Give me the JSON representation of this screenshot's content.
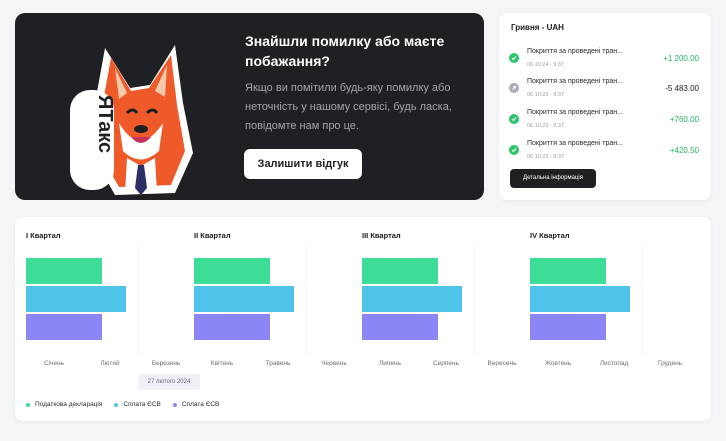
{
  "banner": {
    "title": "Знайшли помилку або маєте побажання?",
    "text": "Якщо ви помітили будь-яку помилку або неточність у нашому сервісі, будь ласка, повідомте нам про це.",
    "button_label": "Залишити відгук",
    "sticker_text": "ЯТакс",
    "background": "#1f2023"
  },
  "transactions": {
    "title": "Гривня - UAH",
    "items": [
      {
        "name": "Покриття за проведені тран...",
        "date": "06.10.24 - 9:37",
        "amount": "+1 200.00",
        "status": "success",
        "icon": "check-icon"
      },
      {
        "name": "Покриття за проведені тран...",
        "date": "06.10.23 - 9:37",
        "amount": "-5 483.00",
        "status": "pending",
        "icon": "arrow-icon"
      },
      {
        "name": "Покриття за проведені тран...",
        "date": "06.10.23 - 9:37",
        "amount": "+760.00",
        "status": "success",
        "icon": "check-icon"
      },
      {
        "name": "Покриття за проведені тран...",
        "date": "06.10.23 - 9:37",
        "amount": "+420.50",
        "status": "success",
        "icon": "check-icon"
      }
    ],
    "details_button": "Детальна інформація",
    "colors": {
      "positive": "#22b35e",
      "negative": "#1b1c20",
      "success_icon": "#2cc56b",
      "pending_icon": "#a8acb8"
    }
  },
  "chart_data": {
    "type": "bar",
    "orientation": "horizontal",
    "quarters": [
      {
        "label": "I Квартал",
        "months": [
          "Січень",
          "Лютий"
        ],
        "values": [
          76,
          100,
          76
        ]
      },
      {
        "label": "II Квартал",
        "months": [
          "Квітень",
          "Травень"
        ],
        "values": [
          76,
          100,
          76
        ]
      },
      {
        "label": "III Квартал",
        "months": [
          "Липень",
          "Серпень"
        ],
        "values": [
          76,
          100,
          76
        ]
      },
      {
        "label": "IV Квартал",
        "months": [
          "Жовтень",
          "Листопад"
        ],
        "values": [
          76,
          100,
          76
        ]
      }
    ],
    "quarter_end_months": [
      "Березень",
      "Червень",
      "Вересень",
      "Грудень"
    ],
    "series": [
      {
        "name": "Податкова декларація",
        "color": "#3ddc97"
      },
      {
        "name": "Сплата ЄСВ",
        "color": "#4fc3e8"
      },
      {
        "name": "Сплата ЄСВ",
        "color": "#8b85f5"
      }
    ],
    "highlight_date": "27 лютого 2024"
  }
}
